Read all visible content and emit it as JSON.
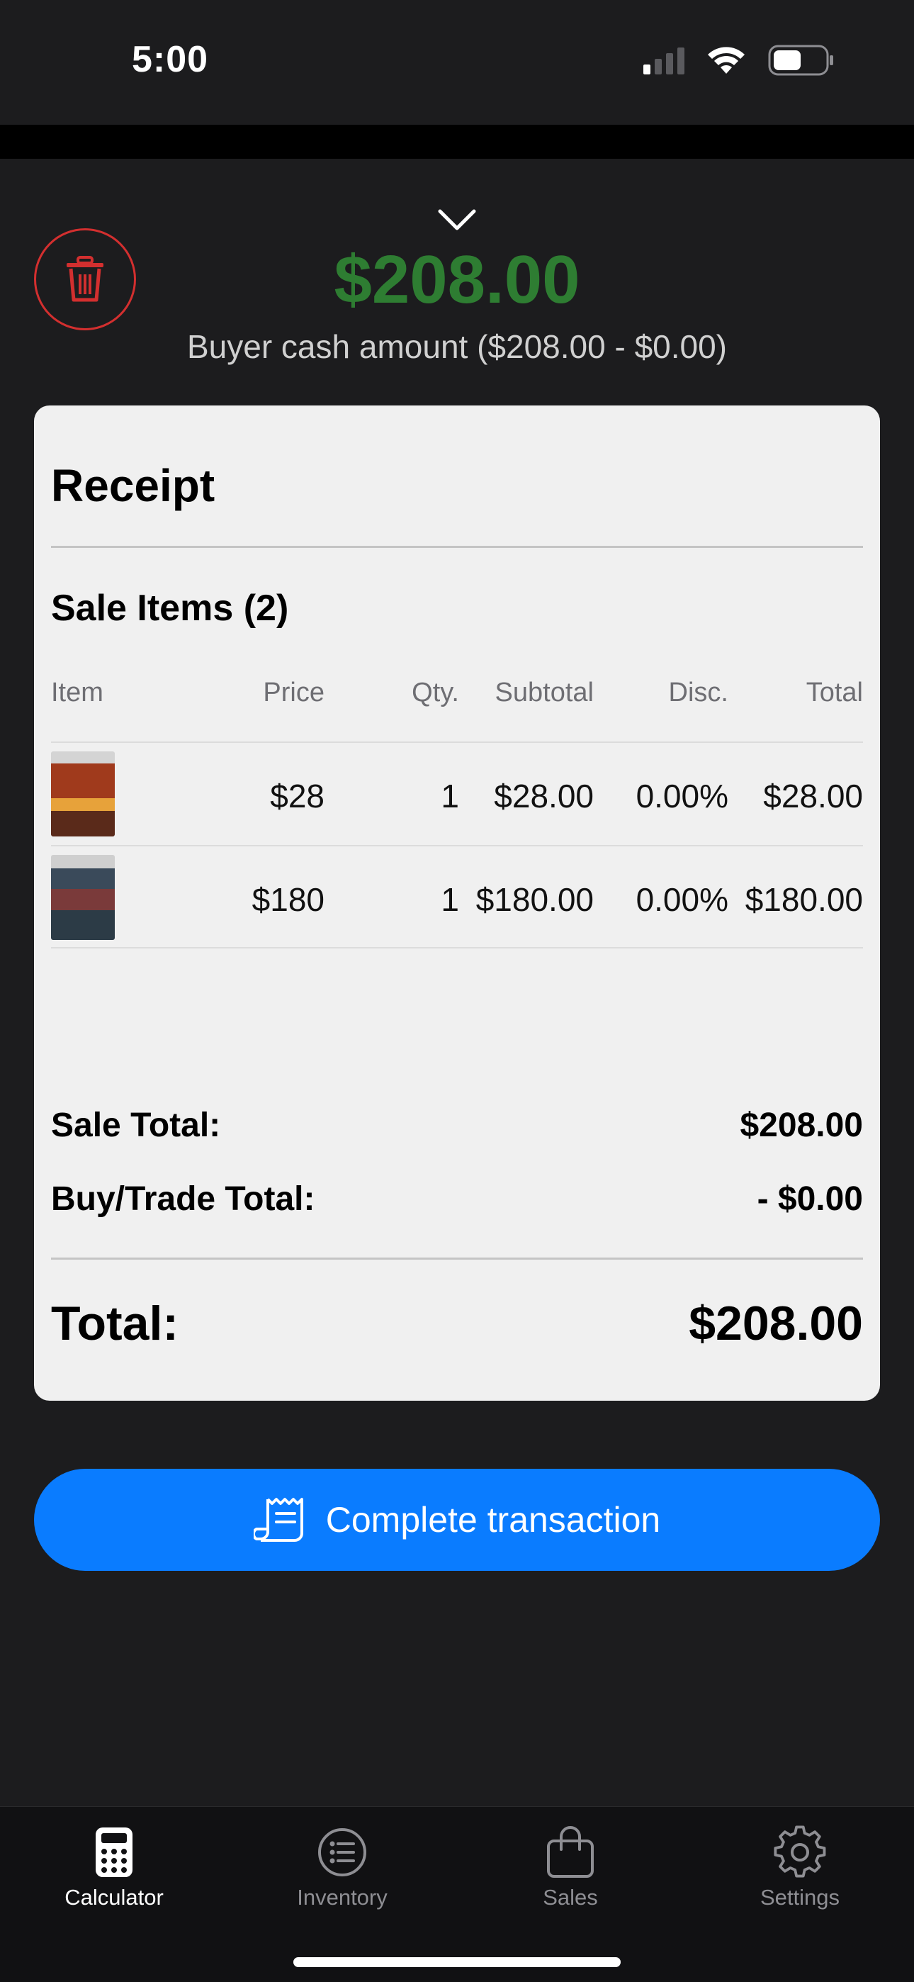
{
  "status_bar": {
    "time": "5:00"
  },
  "header": {
    "amount": "$208.00",
    "subtitle": "Buyer cash amount  ($208.00 - $0.00)",
    "amount_color": "#2e7d32"
  },
  "receipt": {
    "title": "Receipt",
    "sale_items_title": "Sale Items (2)",
    "columns": [
      "Item",
      "Price",
      "Qty.",
      "Subtotal",
      "Disc.",
      "Total"
    ],
    "rows": [
      {
        "price": "$28",
        "qty": "1",
        "subtotal": "$28.00",
        "disc": "0.00%",
        "total": "$28.00"
      },
      {
        "price": "$180",
        "qty": "1",
        "subtotal": "$180.00",
        "disc": "0.00%",
        "total": "$180.00"
      }
    ],
    "sale_total_label": "Sale Total:",
    "sale_total_value": "$208.00",
    "trade_total_label": "Buy/Trade Total:",
    "trade_total_value": "- $0.00",
    "total_label": "Total:",
    "total_value": "$208.00"
  },
  "actions": {
    "complete_label": "Complete transaction",
    "accent": "#0a7cff"
  },
  "tabs": [
    {
      "label": "Calculator",
      "icon": "calculator-icon",
      "active": true
    },
    {
      "label": "Inventory",
      "icon": "list-icon",
      "active": false
    },
    {
      "label": "Sales",
      "icon": "bag-icon",
      "active": false
    },
    {
      "label": "Settings",
      "icon": "gear-icon",
      "active": false
    }
  ]
}
